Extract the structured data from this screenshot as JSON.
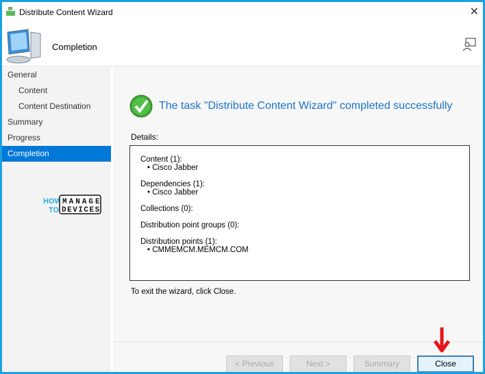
{
  "window": {
    "title": "Distribute Content Wizard",
    "close_glyph": "✕"
  },
  "header": {
    "title": "Completion"
  },
  "nav": {
    "items": [
      {
        "label": "General",
        "sub": false,
        "selected": false
      },
      {
        "label": "Content",
        "sub": true,
        "selected": false
      },
      {
        "label": "Content Destination",
        "sub": true,
        "selected": false
      },
      {
        "label": "Summary",
        "sub": false,
        "selected": false
      },
      {
        "label": "Progress",
        "sub": false,
        "selected": false
      },
      {
        "label": "Completion",
        "sub": false,
        "selected": true
      }
    ]
  },
  "logo": {
    "text": "HOW TO MANAGE DEVICES"
  },
  "main": {
    "success_message": "The task \"Distribute Content Wizard\" completed successfully",
    "details_label": "Details:",
    "details": [
      {
        "heading": "Content (1):",
        "items": [
          "Cisco Jabber"
        ]
      },
      {
        "heading": "Dependencies (1):",
        "items": [
          "Cisco Jabber"
        ]
      },
      {
        "heading": "Collections (0):",
        "items": []
      },
      {
        "heading": "Distribution point groups (0):",
        "items": []
      },
      {
        "heading": "Distribution points (1):",
        "items": [
          "CMMEMCM.MEMCM.COM"
        ]
      }
    ],
    "exit_hint": "To exit the wizard, click Close."
  },
  "buttons": {
    "previous": "< Previous",
    "next": "Next >",
    "summary": "Summary",
    "close": "Close"
  },
  "colors": {
    "accent": "#0078d7",
    "frame": "#1ba1e2",
    "success": "#1a73c8",
    "arrow": "#e8141b"
  }
}
